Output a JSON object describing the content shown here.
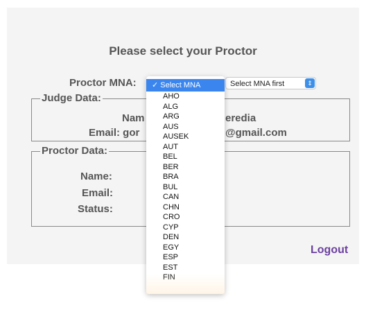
{
  "page": {
    "heading": "Please select your Proctor",
    "mna_label": "Proctor MNA:",
    "second_select_value": "Select MNA first",
    "logout": "Logout"
  },
  "judge": {
    "legend": "Judge Data:",
    "name_label": "Nam",
    "name_value_visible": "eredia",
    "email_label": "Email: gor",
    "email_value_visible": "@gmail.com"
  },
  "proctor": {
    "legend": "Proctor Data:",
    "name_label": "Name:",
    "email_label": "Email:",
    "status_label": "Status:"
  },
  "dropdown": {
    "selected": "Select MNA",
    "checkmark": "✓",
    "options": [
      "AHO",
      "ALG",
      "ARG",
      "AUS",
      "AUSEK",
      "AUT",
      "BEL",
      "BER",
      "BRA",
      "BUL",
      "CAN",
      "CHN",
      "CRO",
      "CYP",
      "DEN",
      "EGY",
      "ESP",
      "EST",
      "FIN"
    ]
  },
  "colors": {
    "accent": "#3b86ee",
    "logout": "#6b3fa0",
    "panel": "#f4f4f4"
  }
}
